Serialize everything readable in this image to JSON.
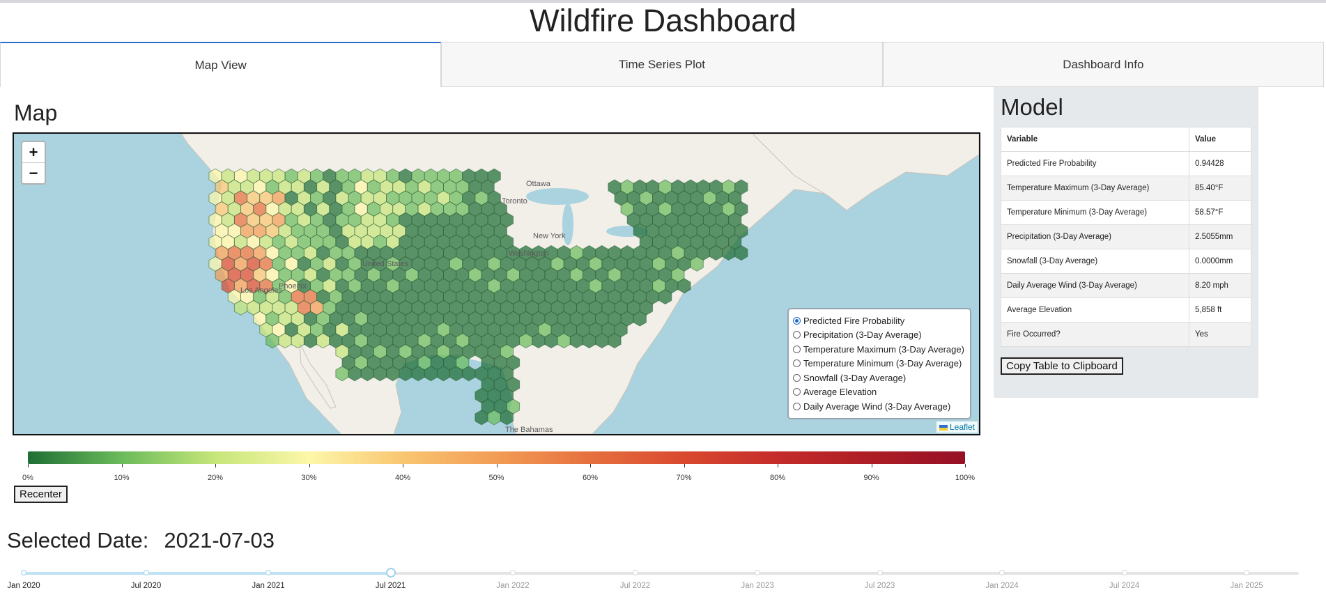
{
  "title": "Wildfire Dashboard",
  "tabs": [
    {
      "label": "Map View",
      "active": true
    },
    {
      "label": "Time Series Plot",
      "active": false
    },
    {
      "label": "Dashboard Info",
      "active": false
    }
  ],
  "map": {
    "heading": "Map",
    "zoom_in": "+",
    "zoom_out": "−",
    "attribution": "Leaflet",
    "place_labels": [
      "Ottawa",
      "Toronto",
      "New York",
      "Washington",
      "United States",
      "Los Angeles",
      "Phoenix",
      "The Bahamas"
    ],
    "layers": [
      {
        "label": "Predicted Fire Probability",
        "selected": true
      },
      {
        "label": "Precipitation (3-Day Average)",
        "selected": false
      },
      {
        "label": "Temperature Maximum (3-Day Average)",
        "selected": false
      },
      {
        "label": "Temperature Minimum (3-Day Average)",
        "selected": false
      },
      {
        "label": "Snowfall (3-Day Average)",
        "selected": false
      },
      {
        "label": "Average Elevation",
        "selected": false
      },
      {
        "label": "Daily Average Wind (3-Day Average)",
        "selected": false
      }
    ],
    "colorscale": [
      "#1f6e35",
      "#6bbb5b",
      "#c6e67a",
      "#fdf7a9",
      "#f9c671",
      "#f29c55",
      "#e6703e",
      "#d9492f",
      "#c42c2a",
      "#ad1d25",
      "#961026"
    ],
    "colorbar_ticks": [
      "0%",
      "10%",
      "20%",
      "30%",
      "40%",
      "50%",
      "60%",
      "70%",
      "80%",
      "90%",
      "100%"
    ],
    "recenter_label": "Recenter"
  },
  "selected_date": {
    "label": "Selected Date:",
    "value": "2021-07-03"
  },
  "date_slider": {
    "marks": [
      "Jan 2020",
      "Jul 2020",
      "Jan 2021",
      "Jul 2021",
      "Jan 2022",
      "Jul 2022",
      "Jan 2023",
      "Jul 2023",
      "Jan 2024",
      "Jul 2024",
      "Jan 2025"
    ],
    "selected_index": 3
  },
  "model": {
    "heading": "Model",
    "columns": [
      "Variable",
      "Value"
    ],
    "rows": [
      [
        "Predicted Fire Probability",
        "0.94428"
      ],
      [
        "Temperature Maximum (3-Day Average)",
        "85.40°F"
      ],
      [
        "Temperature Minimum (3-Day Average)",
        "58.57°F"
      ],
      [
        "Precipitation (3-Day Average)",
        "2.5055mm"
      ],
      [
        "Snowfall (3-Day Average)",
        "0.0000mm"
      ],
      [
        "Daily Average Wind (3-Day Average)",
        "8.20 mph"
      ],
      [
        "Average Elevation",
        "5,858 ft"
      ],
      [
        "Fire Occurred?",
        "Yes"
      ]
    ],
    "copy_label": "Copy Table to Clipboard"
  }
}
